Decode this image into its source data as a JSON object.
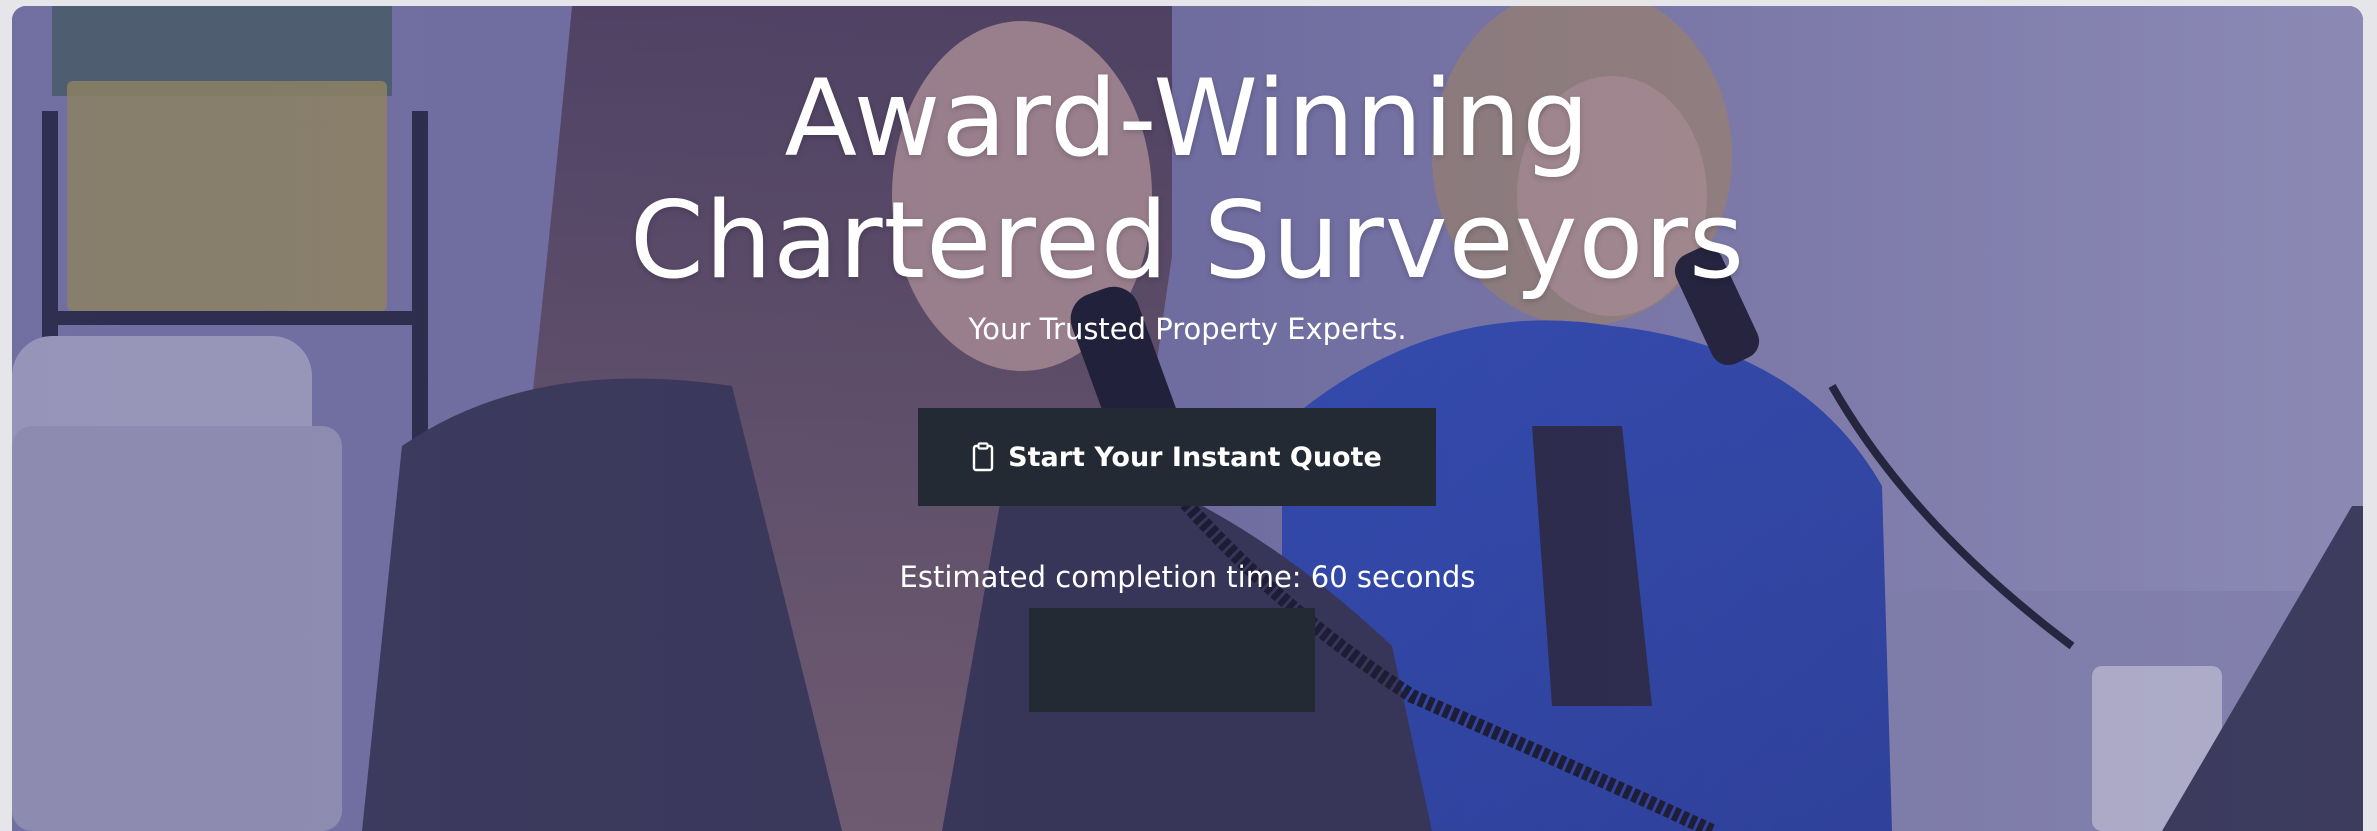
{
  "hero": {
    "headline_line1": "Award-Winning",
    "headline_line2": "Chartered Surveyors",
    "tagline": "Your Trusted Property Experts.",
    "cta_label": "Start Your Instant Quote",
    "cta_icon": "clipboard-icon",
    "estimate_text": "Estimated completion time: 60 seconds",
    "secondary_button_label": ""
  },
  "colors": {
    "overlay": "#4a4690",
    "button_bg": "#242a33",
    "text": "#ffffff"
  }
}
